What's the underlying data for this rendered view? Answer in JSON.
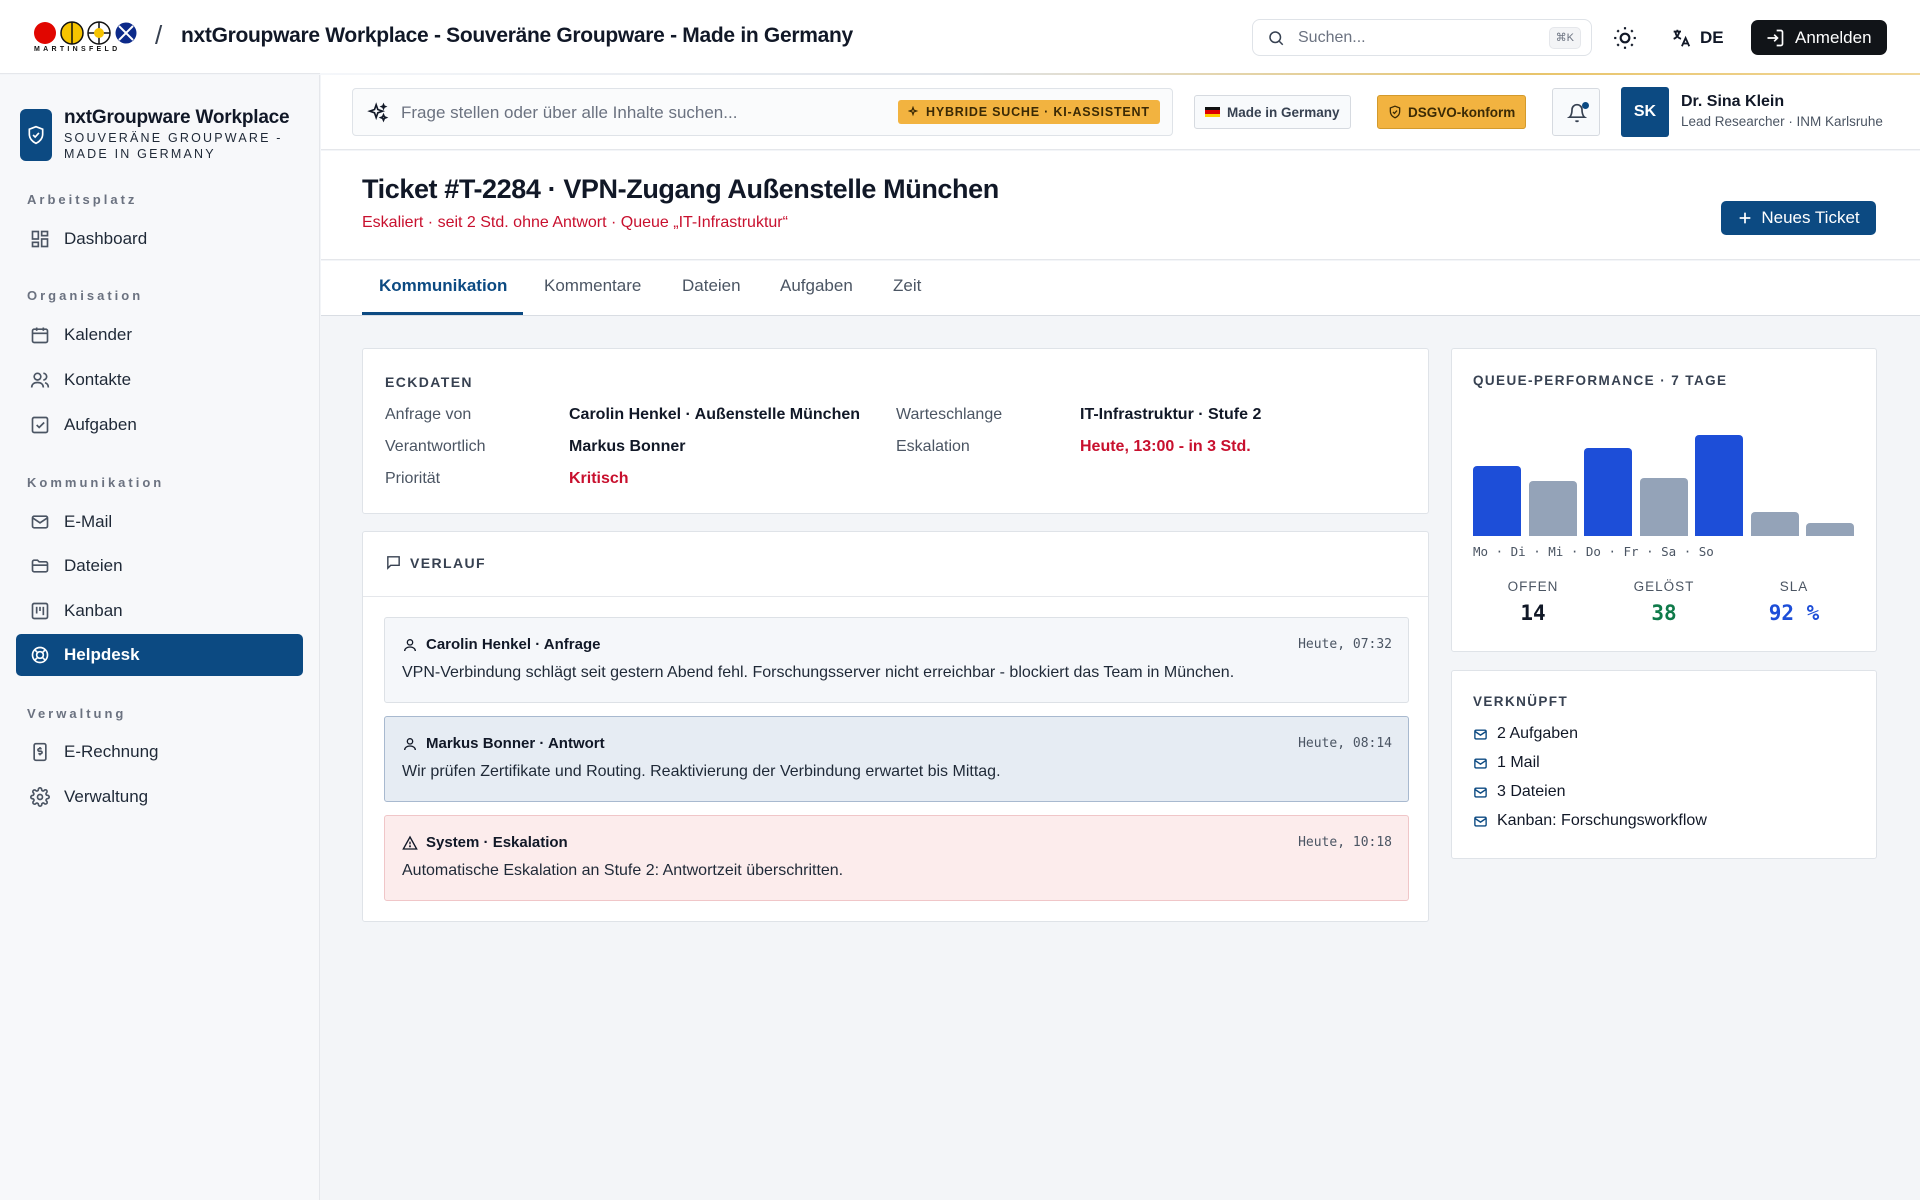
{
  "topbar": {
    "logo_text": "MARTINSFELD",
    "separator": "/",
    "title": "nxtGroupware Workplace - Souveräne Groupware - Made in Germany",
    "search_placeholder": "Suchen...",
    "search_shortcut": "⌘K",
    "language": "DE",
    "login_label": "Anmelden"
  },
  "sidebar": {
    "brand_name": "nxtGroupware Workplace",
    "brand_sub": "Souveräne Groupware - Made in Germany",
    "sections": [
      {
        "title": "Arbeitsplatz",
        "items": [
          {
            "label": "Dashboard",
            "icon": "dashboard-icon"
          }
        ]
      },
      {
        "title": "Organisation",
        "items": [
          {
            "label": "Kalender",
            "icon": "calendar-icon"
          },
          {
            "label": "Kontakte",
            "icon": "contacts-icon"
          },
          {
            "label": "Aufgaben",
            "icon": "tasks-icon"
          }
        ]
      },
      {
        "title": "Kommunikation",
        "items": [
          {
            "label": "E-Mail",
            "icon": "mail-icon"
          },
          {
            "label": "Dateien",
            "icon": "folder-icon"
          },
          {
            "label": "Kanban",
            "icon": "kanban-icon"
          },
          {
            "label": "Helpdesk",
            "icon": "lifebuoy-icon",
            "active": true
          }
        ]
      },
      {
        "title": "Verwaltung",
        "items": [
          {
            "label": "E-Rechnung",
            "icon": "invoice-icon"
          },
          {
            "label": "Verwaltung",
            "icon": "gear-icon"
          }
        ]
      }
    ]
  },
  "header": {
    "ai_search_placeholder": "Frage stellen oder über alle Inhalte suchen...",
    "ai_badge": "HYBRIDE SUCHE · KI-ASSISTENT",
    "made_in_germany": "Made in Germany",
    "gdpr": "DSGVO-konform",
    "user_initials": "SK",
    "user_name": "Dr. Sina Klein",
    "user_role": "Lead Researcher · INM Karlsruhe"
  },
  "ticket": {
    "title": "Ticket #T-2284 · VPN-Zugang Außenstelle München",
    "subtitle": "Eskaliert · seit 2 Std. ohne Antwort · Queue „IT-Infrastruktur“",
    "new_ticket_label": "Neues Ticket"
  },
  "tabs": [
    "Kommunikation",
    "Kommentare",
    "Dateien",
    "Aufgaben",
    "Zeit"
  ],
  "eckdaten": {
    "title": "ECKDATEN",
    "rows": [
      {
        "key": "Anfrage von",
        "value": "Carolin Henkel · Außenstelle München"
      },
      {
        "key": "Verantwortlich",
        "value": "Markus Bonner"
      },
      {
        "key": "Priorität",
        "value": "Kritisch"
      },
      {
        "key": "Warteschlange",
        "value": "IT-Infrastruktur · Stufe 2"
      },
      {
        "key": "Eskalation",
        "value": "Heute, 13:00 - in 3 Std."
      }
    ]
  },
  "verlauf": {
    "title": "VERLAUF",
    "messages": [
      {
        "author": "Carolin Henkel · Anfrage",
        "time": "Heute, 07:32",
        "text": "VPN-Verbindung schlägt seit gestern Abend fehl. Forschungsserver nicht erreichbar - blockiert das Team in München."
      },
      {
        "author": "Markus Bonner · Antwort",
        "time": "Heute, 08:14",
        "text": "Wir prüfen Zertifikate und Routing. Reaktivierung der Verbindung erwartet bis Mittag."
      },
      {
        "author": "System · Eskalation",
        "time": "Heute, 10:18",
        "text": "Automatische Eskalation an Stufe 2: Antwortzeit überschritten."
      }
    ]
  },
  "queue": {
    "title": "QUEUE-PERFORMANCE · 7 TAGE",
    "day_labels": "Mo · Di · Mi · Do · Fr · Sa · So",
    "stats": [
      {
        "label": "OFFEN",
        "value": "14",
        "color": "#111827"
      },
      {
        "label": "GELÖST",
        "value": "38",
        "color": "#0f7a4a"
      },
      {
        "label": "SLA",
        "value": "92 %",
        "color": "#1d4ed8"
      }
    ]
  },
  "chart_data": {
    "type": "bar",
    "categories": [
      "Mo",
      "Di",
      "Mi",
      "Do",
      "Fr",
      "Sa",
      "So"
    ],
    "values": [
      6,
      4.7,
      7.6,
      5,
      8.7,
      2.1,
      1.1
    ],
    "highlight": [
      true,
      false,
      true,
      false,
      true,
      false,
      false
    ],
    "colors": {
      "highlight": "#1d4ed8",
      "normal": "#94a3b8"
    },
    "title": "QUEUE-PERFORMANCE · 7 TAGE",
    "ylim": [
      0,
      10
    ]
  },
  "linked": {
    "title": "VERKNÜPFT",
    "items": [
      "2 Aufgaben",
      "1 Mail",
      "3 Dateien",
      "Kanban: Forschungsworkflow"
    ]
  },
  "colors": {
    "primary": "#0c4a82",
    "alert": "#c8102e",
    "gold": "#f2b340"
  }
}
